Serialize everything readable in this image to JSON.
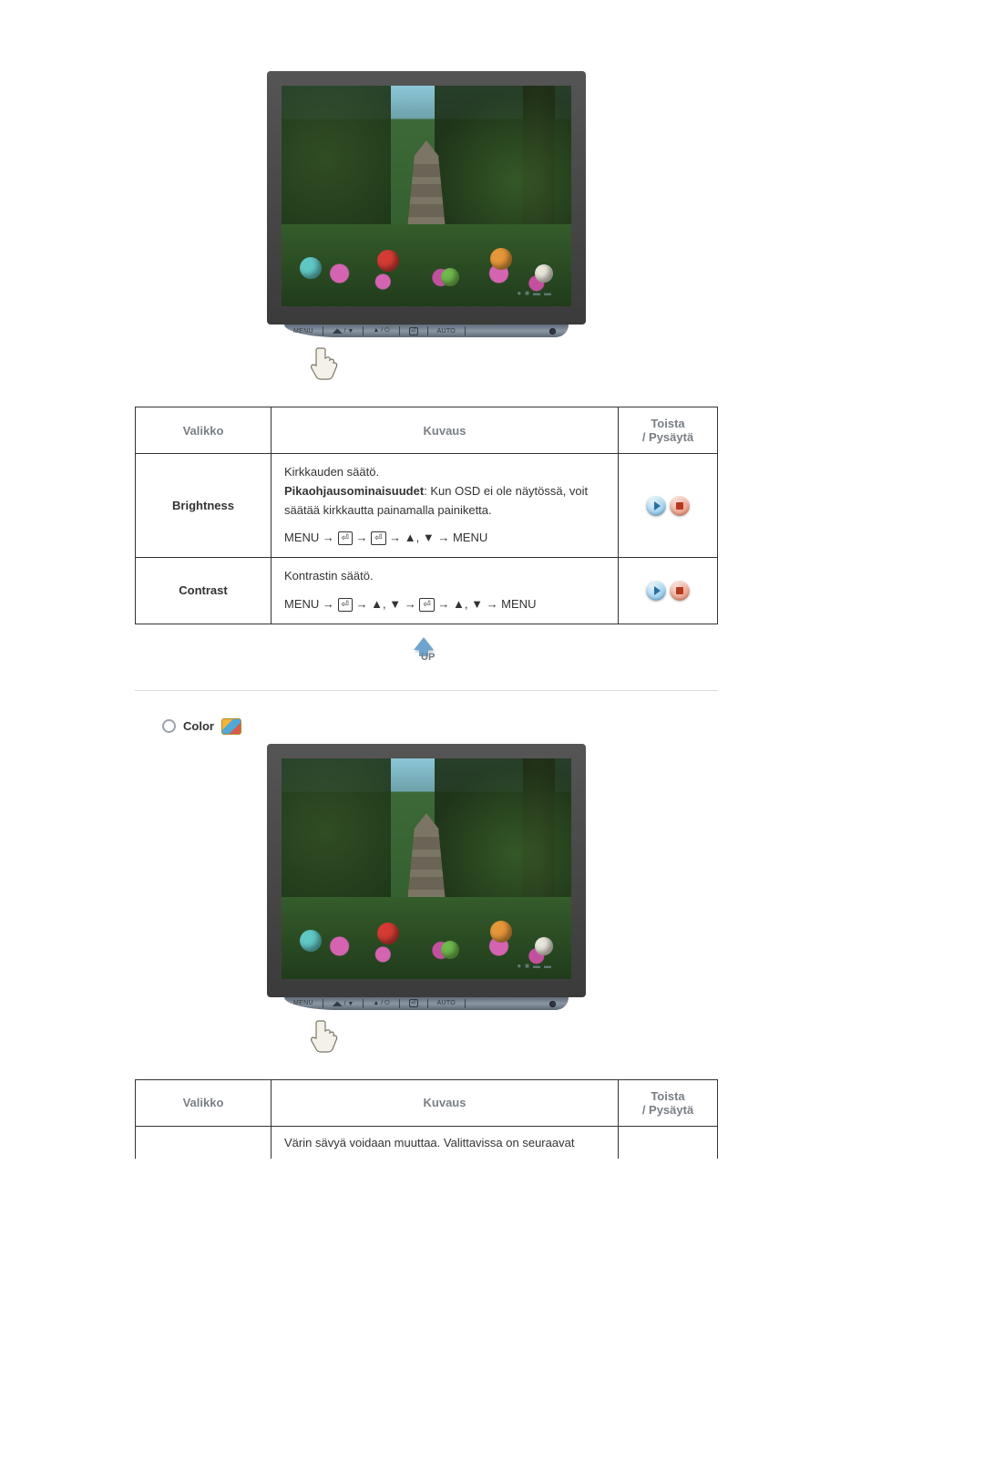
{
  "table1": {
    "headers": {
      "menu": "Valikko",
      "desc": "Kuvaus",
      "play": "Toista\n/ Pysäytä"
    },
    "rows": [
      {
        "label": "Brightness",
        "desc_line1": "Kirkkauden säätö.",
        "desc_bold": "Pikaohjausominaisuudet",
        "desc_rest": ": Kun OSD ei ole näytössä, voit säätää kirkkautta painamalla painiketta.",
        "nav": "MENU → ⏎ → ⏎ → ▲, ▼ → MENU"
      },
      {
        "label": "Contrast",
        "desc_line1": "Kontrastin säätö.",
        "nav": "MENU → ⏎ → ▲, ▼ → ⏎ → ▲, ▼ → MENU"
      }
    ]
  },
  "up_label": "UP",
  "section2": {
    "title": "Color"
  },
  "table2": {
    "headers": {
      "menu": "Valikko",
      "desc": "Kuvaus",
      "play": "Toista\n/ Pysäytä"
    },
    "row_desc": "Värin sävyä voidaan muuttaa. Valittavissa on seuraavat"
  },
  "monitor_buttons": {
    "menu": "MENU",
    "auto": "AUTO"
  }
}
